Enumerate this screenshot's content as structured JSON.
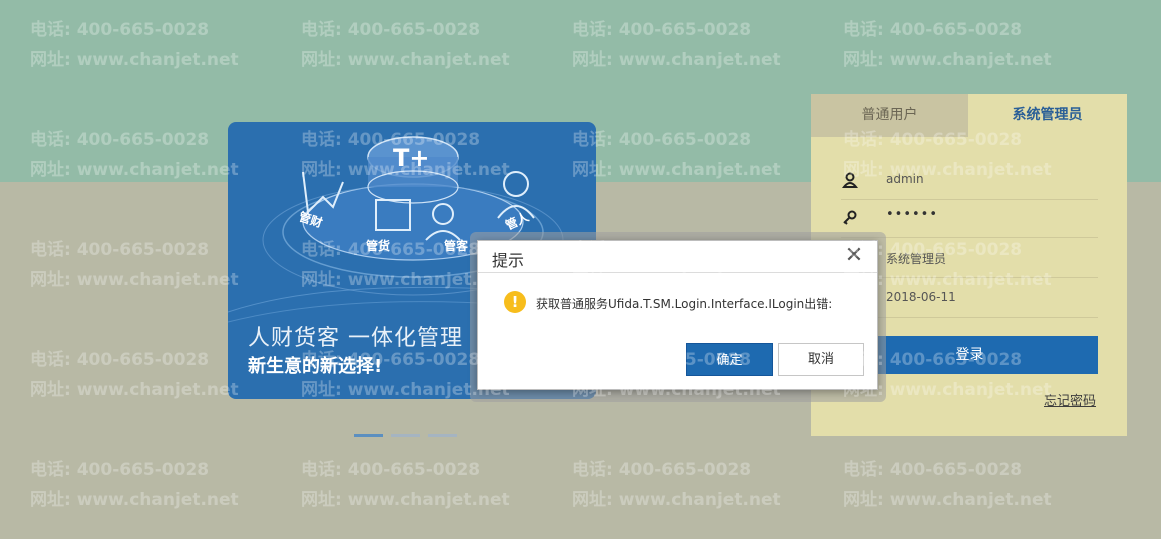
{
  "watermark": {
    "phone": "电话: 400-665-0028",
    "site": "网址: www.chanjet.net"
  },
  "banner": {
    "logo": "T+",
    "ring_labels": [
      "管财",
      "管货",
      "管客",
      "管人"
    ],
    "line1": "人财货客 一体化管理",
    "line2": "新生意的新选择!"
  },
  "login": {
    "tab_normal": "普通用户",
    "tab_admin": "系统管理员",
    "username": "admin",
    "password_mask": "••••••",
    "role": "系统管理员",
    "date": "2018-06-11",
    "submit": "登录",
    "forgot": "忘记密码"
  },
  "dialog": {
    "title": "提示",
    "message": "获取普通服务Ufida.T.SM.Login.Interface.ILogin出错:",
    "ok": "确定",
    "cancel": "取消",
    "icon": "warning-icon"
  },
  "colors": {
    "accent": "#1e6ab0",
    "top_band": "#93bba7",
    "lower_band": "#b8b9a5",
    "login_panel": "#e3deaa",
    "warning": "#f7bd1c"
  }
}
